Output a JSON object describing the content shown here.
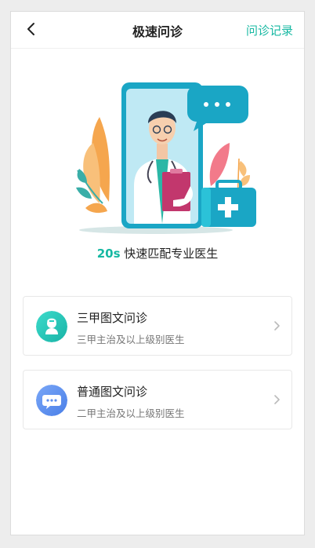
{
  "header": {
    "title": "极速问诊",
    "record_link": "问诊记录"
  },
  "banner": {
    "highlight": "20s",
    "text": " 快速匹配专业医生"
  },
  "options": [
    {
      "name": "三甲图文问诊",
      "desc": "三甲主治及以上级别医生",
      "icon": "doctor-icon"
    },
    {
      "name": "普通图文问诊",
      "desc": "二甲主治及以上级别医生",
      "icon": "chat-bubble-icon"
    }
  ],
  "colors": {
    "accent": "#16b8a2",
    "icon1": "#2bcfc0",
    "icon2": "#5b8ef0"
  }
}
